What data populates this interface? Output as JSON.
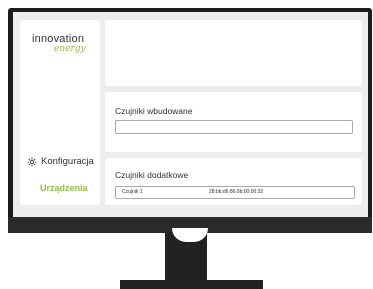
{
  "brand": {
    "name": "innovation",
    "tagline": "energy",
    "accent_color": "#8fc04c"
  },
  "sidebar": {
    "config_label": "Konfiguracja",
    "config_icon": "gear-icon",
    "devices_label": "Urządzenia"
  },
  "builtin_sensors": {
    "title": "Czujniki wbudowane",
    "value": ""
  },
  "extra_sensors": {
    "title": "Czujniki dodatkowe",
    "items": [
      {
        "name": "Czujnik 1",
        "address": "28:bb:d6:86:0b:00:00:32"
      }
    ]
  }
}
